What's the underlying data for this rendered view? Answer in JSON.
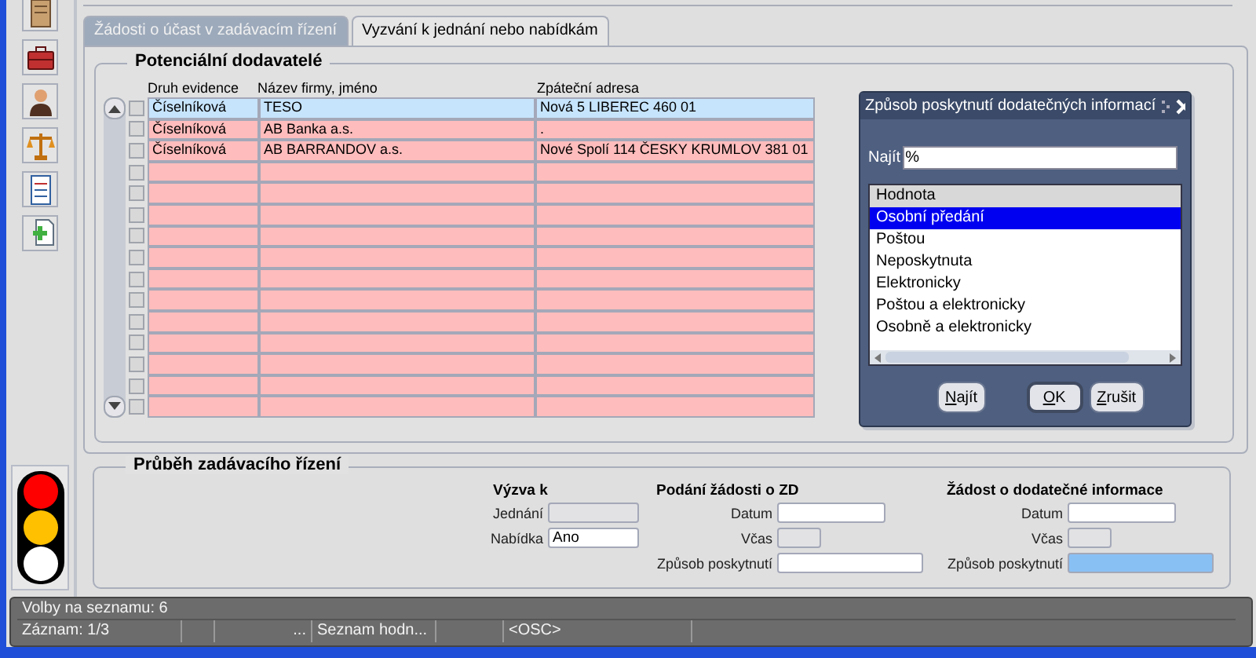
{
  "toolbar": {
    "items": [
      {
        "kind": "notebook"
      },
      {
        "kind": "toolbox"
      },
      {
        "kind": "person"
      },
      {
        "kind": "scales"
      },
      {
        "kind": "document"
      },
      {
        "kind": "add-document"
      }
    ]
  },
  "traffic_light": {
    "lights": [
      {
        "color": "#ff0000"
      },
      {
        "color": "#ffc000"
      },
      {
        "color": "#ffffff"
      }
    ]
  },
  "tabs": [
    {
      "label": "Žádosti o účast v zadávacím řízení",
      "selected": false
    },
    {
      "label": "Vyzvání k jednání nebo nabídkám",
      "selected": true
    }
  ],
  "suppliers": {
    "title": "Potenciální dodavatelé",
    "columns": [
      "Druh evidence",
      "Název firmy, jméno",
      "Zpáteční adresa"
    ],
    "rows": [
      {
        "cells": [
          "Číselníková",
          "TESO",
          "Nová 5 LIBEREC 460 01"
        ],
        "selected": true,
        "checked": false
      },
      {
        "cells": [
          "Číselníková",
          "AB Banka a.s.",
          "."
        ],
        "selected": false,
        "checked": false
      },
      {
        "cells": [
          "Číselníková",
          "AB BARRANDOV a.s.",
          "Nové Spolí 114 ČESKY KRUMLOV 381 01"
        ],
        "selected": false,
        "checked": false
      }
    ],
    "blank_rows": [
      {
        "checked": false
      },
      {
        "checked": false
      },
      {
        "checked": false
      },
      {
        "checked": false
      },
      {
        "checked": false
      },
      {
        "checked": false
      },
      {
        "checked": false
      },
      {
        "checked": false
      },
      {
        "checked": false
      },
      {
        "checked": false
      },
      {
        "checked": false
      },
      {
        "checked": false
      }
    ]
  },
  "dialog": {
    "title": "Způsob poskytnutí dodatečných informací",
    "find_label": "Najít",
    "find_value": "%",
    "list_header": "Hodnota",
    "items": [
      {
        "label": "Osobní předání",
        "selected": true
      },
      {
        "label": "Poštou",
        "selected": false
      },
      {
        "label": "Neposkytnuta",
        "selected": false
      },
      {
        "label": "Elektronicky",
        "selected": false
      },
      {
        "label": "Poštou a elektronicky",
        "selected": false
      },
      {
        "label": "Osobně a elektronicky",
        "selected": false
      }
    ],
    "buttons": [
      {
        "label": "Najít",
        "kind": "normal"
      },
      {
        "label": "OK",
        "kind": "default"
      },
      {
        "label": "Zrušit",
        "kind": "normal"
      }
    ]
  },
  "progress": {
    "title": "Průběh zadávacího řízení",
    "groups": [
      {
        "heading": "Výzva k",
        "fields": [
          {
            "label": "Jednání",
            "kind": "choice",
            "disabled": true,
            "focused": false
          },
          {
            "label": "Nabídka",
            "value": "Ano",
            "kind": "choice",
            "disabled": false,
            "focused": false
          }
        ]
      },
      {
        "heading": "Podání žádosti o ZD",
        "fields": [
          {
            "label": "Datum",
            "kind": "date",
            "disabled": false,
            "focused": false
          },
          {
            "label": "Včas",
            "kind": "flag",
            "disabled": true,
            "focused": false
          },
          {
            "label": "Způsob poskytnutí",
            "kind": "method",
            "disabled": false,
            "focused": false
          }
        ]
      },
      {
        "heading": "Žádost o dodatečné informace",
        "fields": [
          {
            "label": "Datum",
            "kind": "date",
            "disabled": false,
            "focused": false
          },
          {
            "label": "Včas",
            "kind": "flag",
            "disabled": true,
            "focused": false
          },
          {
            "label": "Způsob poskytnutí",
            "kind": "method",
            "disabled": false,
            "focused": true
          }
        ]
      }
    ]
  },
  "status_bar": {
    "message": "Volby na seznamu: 6",
    "segments": [
      "Záznam: 1/3",
      "...",
      "Seznam hodn...",
      "<OSC>"
    ]
  }
}
